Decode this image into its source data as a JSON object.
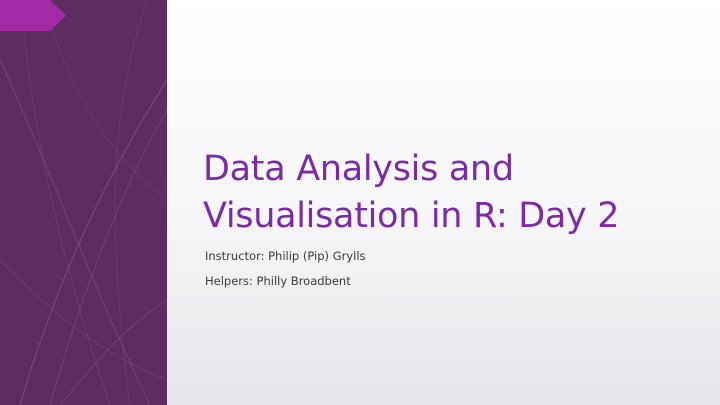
{
  "slide": {
    "title_line_1": "Data Analysis and",
    "title_line_2": "Visualisation in R: Day 2",
    "instructor": "Instructor: Philip (Pip) Grylls",
    "helpers": "Helpers: Philly Broadbent"
  },
  "colors": {
    "side_panel": "#5f2c61",
    "accent_tab": "#a22aa5",
    "title": "#7b2ba8",
    "body_text": "#3a3a3a"
  }
}
